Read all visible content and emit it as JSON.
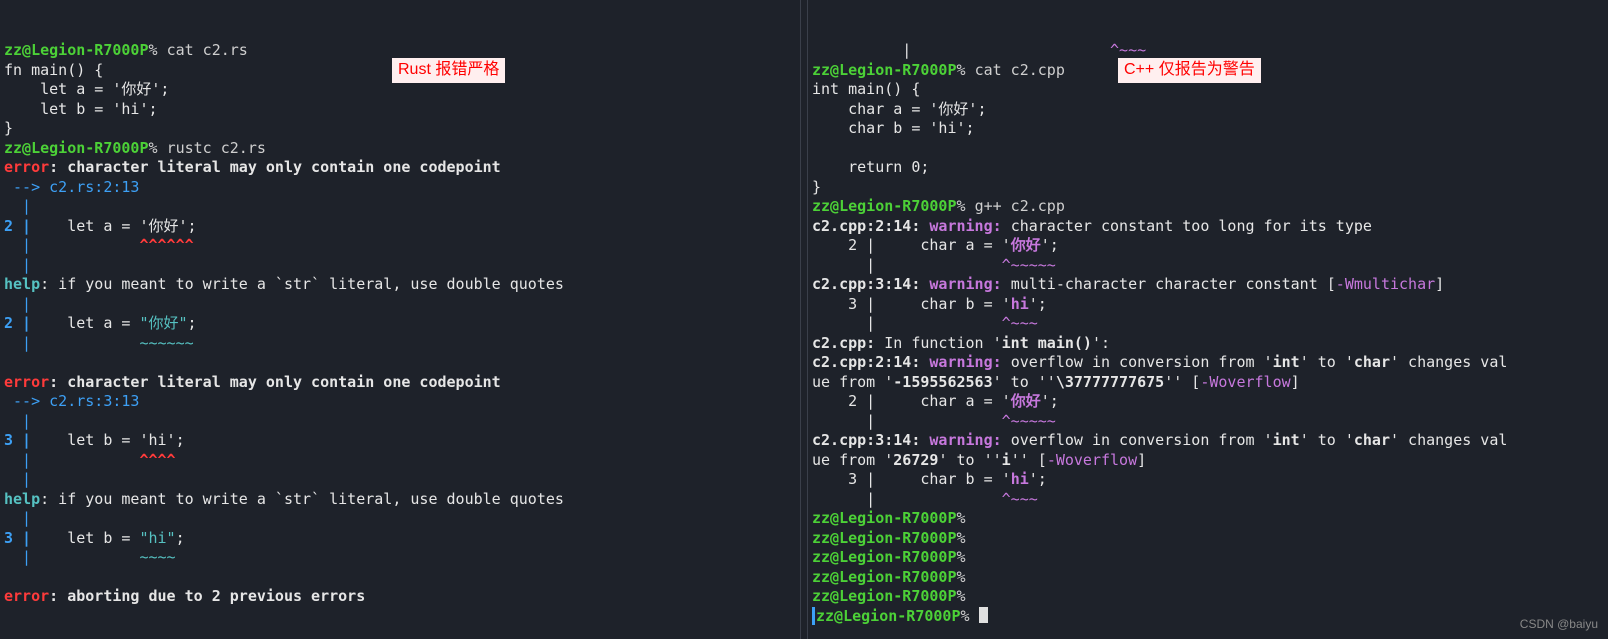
{
  "left": {
    "prompt": "zz@Legion-R7000P",
    "cmd1": "cat c2.rs",
    "src": [
      "fn main() {",
      "    let a = '你好';",
      "    let b = 'hi';",
      "}"
    ],
    "cmd2": "rustc c2.rs",
    "err1_head": ": character literal may only contain one codepoint",
    "err1_arrow": " --> c2.rs:2:13",
    "err1_code": "    let a = '你好';",
    "err1_caret": "            ^^^^^^",
    "help_text": ": if you meant to write a `str` literal, use double quotes",
    "fix1_code": "    let a = \"你好\";",
    "fix1_tilde": "            ~~~~~~",
    "err2_arrow": " --> c2.rs:3:13",
    "err2_code": "    let b = 'hi';",
    "err2_caret": "            ^^^^",
    "fix2_code": "    let b = \"hi\";",
    "fix2_tilde": "            ~~~~",
    "abort": ": aborting due to 2 previous errors",
    "label": "Rust 报错严格"
  },
  "right": {
    "gutter0": "          |                      ",
    "gutter0_caret": "^~~~",
    "prompt": "zz@Legion-R7000P",
    "cmd1": "cat c2.cpp",
    "src": [
      "int main() {",
      "    char a = '你好';",
      "    char b = 'hi';",
      "",
      "    return 0;",
      "}"
    ],
    "cmd2": "g++ c2.cpp",
    "w1_loc": "c2.cpp:2:14: ",
    "w1_lbl": "warning: ",
    "w1_msg": "character constant too long for its type",
    "w1_code_ln": "    2 |     char a = '",
    "w1_code_lit": "你好",
    "w1_code_end": "';",
    "w1_gut": "      |              ",
    "w1_caret": "^~~~~~",
    "w2_loc": "c2.cpp:3:14: ",
    "w2_msg_a": "multi-character character constant [",
    "w2_flag": "-Wmultichar",
    "w2_code_ln": "    3 |     char b = '",
    "w2_code_lit": "hi",
    "w2_caret": "^~~~",
    "in_fn_a": "c2.cpp:",
    "in_fn_b": " In function '",
    "in_fn_c": "int main()",
    "in_fn_d": "':",
    "w3_msg_a": "overflow in conversion from '",
    "w3_int": "int",
    "w3_msg_b": "' to '",
    "w3_char": "char",
    "w3_msg_c": "' changes val",
    "w3_line2_a": "ue from '",
    "w3_val1": "-1595562563",
    "w3_line2_b": "' to ''",
    "w3_val2": "\\37777777675",
    "w3_line2_c": "'' [",
    "w3_flag": "-Woverflow",
    "w4_line2_a": "ue from '",
    "w4_val1": "26729",
    "w4_line2_b": "' to ''",
    "w4_val2": "i",
    "w4_line2_c": "'' [",
    "label": "C++ 仅报告为警告"
  },
  "watermark": "CSDN @baiyu"
}
